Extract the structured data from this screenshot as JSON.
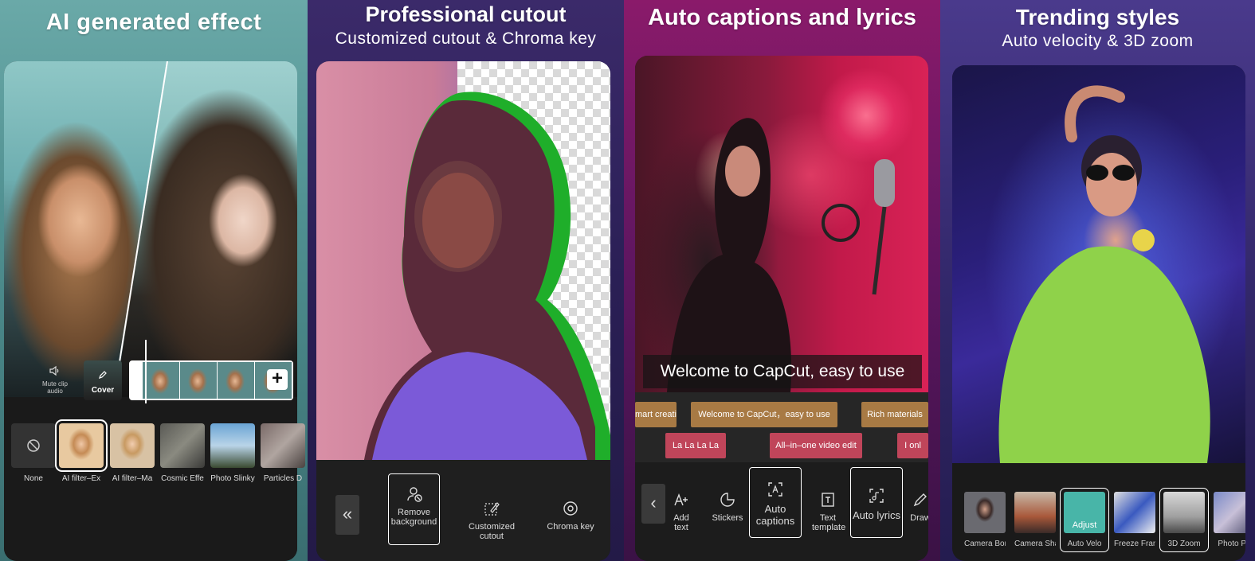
{
  "panels": {
    "ai": {
      "heading": "AI generated effect",
      "mute_label": "Mute clip audio",
      "cover_label": "Cover",
      "filters": [
        {
          "label": "None"
        },
        {
          "label": "AI filter–Ex"
        },
        {
          "label": "AI filter–Ma"
        },
        {
          "label": "Cosmic Effe"
        },
        {
          "label": "Photo Slinky"
        },
        {
          "label": "Particles D"
        }
      ]
    },
    "cutout": {
      "heading": "Professional cutout",
      "subheading": "Customized cutout & Chroma key",
      "tools": [
        {
          "label": "Remove background"
        },
        {
          "label": "Customized cutout"
        },
        {
          "label": "Chroma key"
        }
      ],
      "back_glyph": "«"
    },
    "captions": {
      "heading": "Auto captions and lyrics",
      "caption_text": "Welcome to CapCut, easy to use",
      "track_row1": [
        "mart creatio",
        "Welcome to CapCut，easy to use",
        "Rich materials"
      ],
      "track_row2": [
        "La La La La",
        "All–in–one video edit",
        "I onl"
      ],
      "tools": [
        {
          "label": "Add text"
        },
        {
          "label": "Stickers"
        },
        {
          "label": "Auto captions"
        },
        {
          "label": "Text template"
        },
        {
          "label": "Auto lyrics"
        },
        {
          "label": "Draw"
        }
      ]
    },
    "trending": {
      "heading": "Trending styles",
      "subheading": "Auto velocity & 3D zoom",
      "styles": [
        {
          "label": "Camera Bor"
        },
        {
          "label": "Camera Sha"
        },
        {
          "label": "Auto Velo",
          "thumb_label": "Adjust"
        },
        {
          "label": "Freeze Fran"
        },
        {
          "label": "3D Zoom"
        },
        {
          "label": "Photo Pu"
        }
      ]
    }
  },
  "colors": {
    "chroma_green": "#1fae2a",
    "caption_clip": "#a87a44",
    "lyric_clip": "#c0455a",
    "adjust_accent": "#48b5a8"
  }
}
